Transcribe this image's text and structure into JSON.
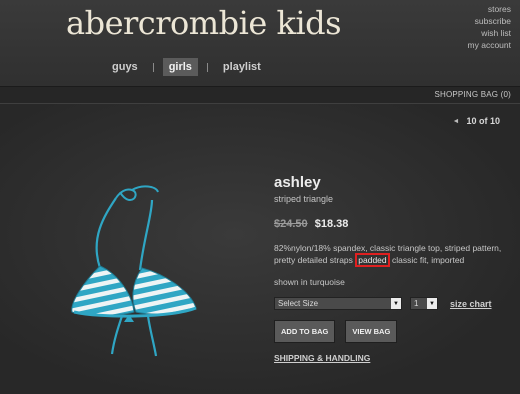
{
  "header": {
    "logo": "abercrombie kids",
    "util_links": [
      "stores",
      "subscribe",
      "wish list",
      "my account"
    ]
  },
  "nav": {
    "guys": "guys",
    "girls": "girls",
    "playlist": "playlist"
  },
  "bag": {
    "label": "SHOPPING BAG (0)"
  },
  "pager": {
    "text": "10 of 10"
  },
  "product": {
    "name": "ashley",
    "subtitle": "striped triangle",
    "old_price": "$24.50",
    "new_price": "$18.38",
    "desc_before": "82%nylon/18% spandex, classic triangle top, striped pattern, pretty detailed straps ",
    "desc_highlight": "padded",
    "desc_after": " classic fit, imported",
    "shown_in": "shown in turquoise",
    "size_select": "Select Size",
    "qty_select": "1",
    "size_chart": "size chart",
    "add_to_bag": "ADD TO BAG",
    "view_bag": "VIEW BAG",
    "shipping": "SHIPPING & HANDLING"
  },
  "colors": {
    "turquoise": "#2fa6c4",
    "highlight": "#e02020"
  }
}
